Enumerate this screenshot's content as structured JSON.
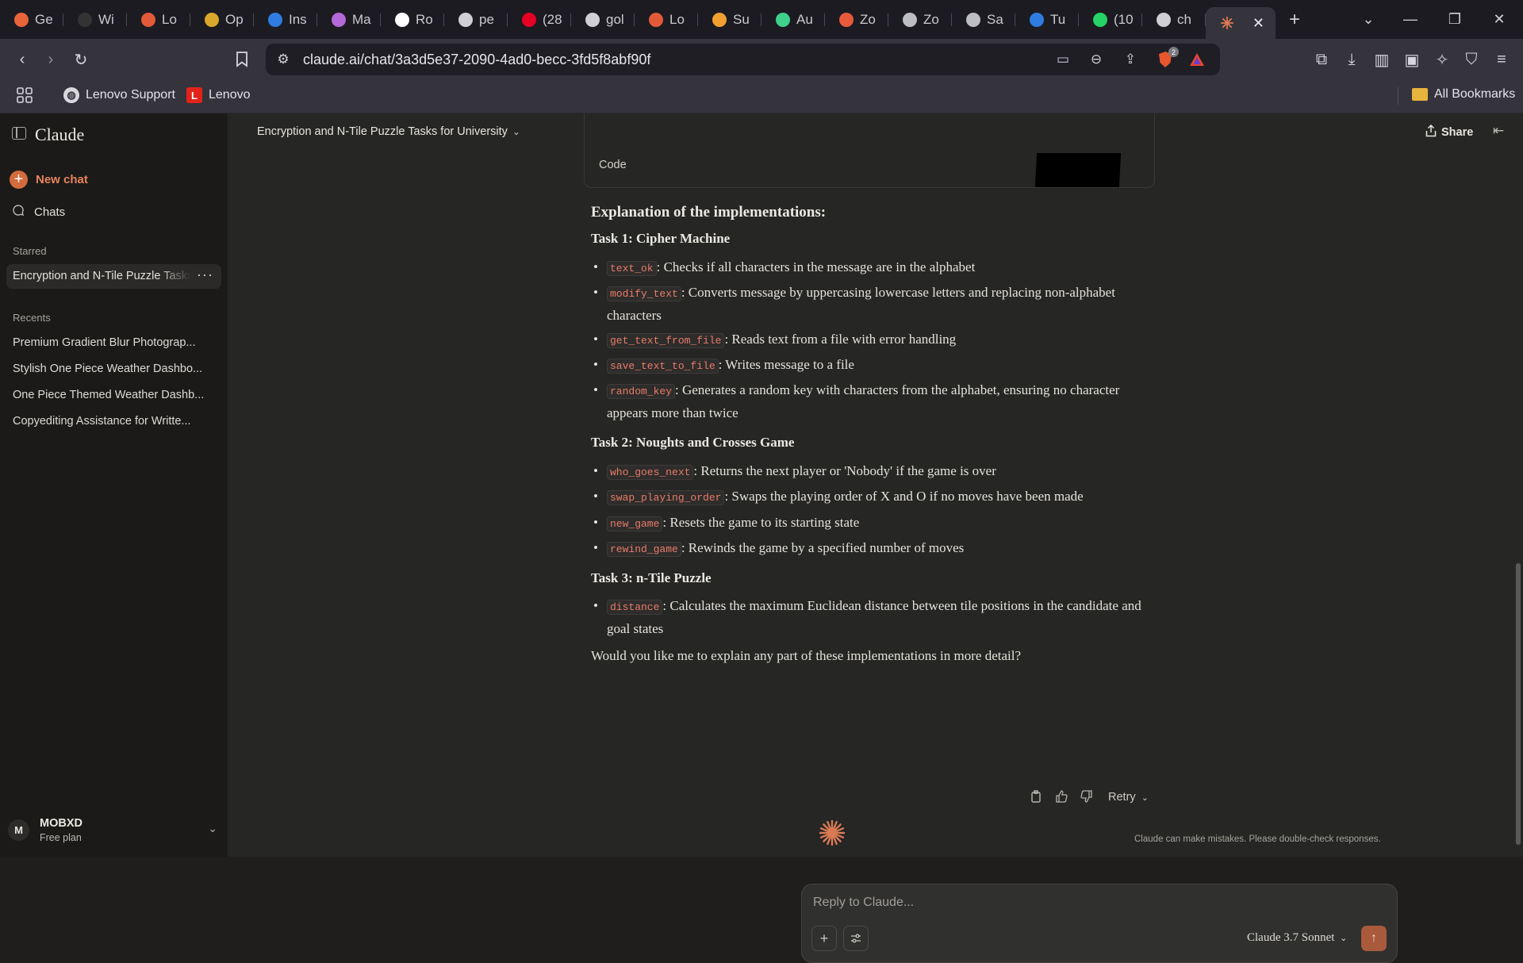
{
  "browser": {
    "tabs": [
      {
        "label": "Ge",
        "icon": "flame-icon",
        "color": "#e8643a"
      },
      {
        "label": "Wi",
        "icon": "circle-icon",
        "color": "#333333"
      },
      {
        "label": "Lo",
        "icon": "heart-icon",
        "color": "#e25a3a"
      },
      {
        "label": "Op",
        "icon": "eyes-icon",
        "color": "#d9a72b"
      },
      {
        "label": "Ins",
        "icon": "windows-icon",
        "color": "#2f7de1"
      },
      {
        "label": "Ma",
        "icon": "gradient-icon",
        "color": "#b469d6"
      },
      {
        "label": "Ro",
        "icon": "record-icon",
        "color": "#ffffff"
      },
      {
        "label": "pe",
        "icon": "shield-icon",
        "color": "#cfcfd5"
      },
      {
        "label": "(28",
        "icon": "pinterest-icon",
        "color": "#e60023"
      },
      {
        "label": "gol",
        "icon": "shield-icon",
        "color": "#cfcfd5"
      },
      {
        "label": "Lo",
        "icon": "heart-icon",
        "color": "#e25a3a"
      },
      {
        "label": "Su",
        "icon": "heart-icon",
        "color": "#f0a030"
      },
      {
        "label": "Au",
        "icon": "bolt-icon",
        "color": "#3fd18c"
      },
      {
        "label": "Zo",
        "icon": "dots-icon",
        "color": "#e85a3a"
      },
      {
        "label": "Zo",
        "icon": "globe-icon",
        "color": "#bdbdc4"
      },
      {
        "label": "Sa",
        "icon": "globe-icon",
        "color": "#bdbdc4"
      },
      {
        "label": "Tu",
        "icon": "ring-icon",
        "color": "#2f7de1"
      },
      {
        "label": "(10",
        "icon": "whatsapp-icon",
        "color": "#25d366"
      },
      {
        "label": "ch",
        "icon": "shield-icon",
        "color": "#cfcfd5"
      }
    ],
    "active_tab_icon": "claude-spark-icon",
    "url": "claude.ai/chat/3a3d5e37-2090-4ad0-becc-3fd5f8abf90f",
    "brave_badge": "2",
    "bookmarks": [
      {
        "label": "Lenovo Support",
        "icon": "globe-icon"
      },
      {
        "label": "Lenovo",
        "icon": "lenovo-icon",
        "glyph": "L"
      }
    ],
    "all_bookmarks": "All Bookmarks"
  },
  "sidebar": {
    "brand": "Claude",
    "new_chat": "New chat",
    "chats": "Chats",
    "starred_heading": "Starred",
    "starred_item": "Encryption and N-Tile Puzzle Tasks for University",
    "recents_heading": "Recents",
    "recents": [
      "Premium Gradient Blur Photograp...",
      "Stylish One Piece Weather Dashbo...",
      "One Piece Themed Weather Dashb...",
      "Copyediting Assistance for Writte..."
    ],
    "user": {
      "initial": "M",
      "name": "MOBXD",
      "plan": "Free plan"
    }
  },
  "header": {
    "title": "Encryption and N-Tile Puzzle Tasks for University",
    "share": "Share"
  },
  "message": {
    "code_label": "Code",
    "heading": "Explanation of the implementations:",
    "sections": [
      {
        "title": "Task 1: Cipher Machine",
        "items": [
          {
            "code": "text_ok",
            "text": ": Checks if all characters in the message are in the alphabet"
          },
          {
            "code": "modify_text",
            "text": ": Converts message by uppercasing lowercase letters and replacing non-alphabet characters"
          },
          {
            "code": "get_text_from_file",
            "text": ": Reads text from a file with error handling"
          },
          {
            "code": "save_text_to_file",
            "text": ": Writes message to a file"
          },
          {
            "code": "random_key",
            "text": ": Generates a random key with characters from the alphabet, ensuring no character appears more than twice"
          }
        ]
      },
      {
        "title": "Task 2: Noughts and Crosses Game",
        "items": [
          {
            "code": "who_goes_next",
            "text": ": Returns the next player or 'Nobody' if the game is over"
          },
          {
            "code": "swap_playing_order",
            "text": ": Swaps the playing order of X and O if no moves have been made"
          },
          {
            "code": "new_game",
            "text": ": Resets the game to its starting state"
          },
          {
            "code": "rewind_game",
            "text": ": Rewinds the game by a specified number of moves"
          }
        ]
      },
      {
        "title": "Task 3: n-Tile Puzzle",
        "items": [
          {
            "code": "distance",
            "text": ": Calculates the maximum Euclidean distance between tile positions in the candidate and goal states"
          }
        ]
      }
    ],
    "closing": "Would you like me to explain any part of these implementations in more detail?",
    "retry": "Retry",
    "disclaimer": "Claude can make mistakes. Please double-check responses."
  },
  "composer": {
    "placeholder": "Reply to Claude...",
    "model": "Claude 3.7 Sonnet"
  },
  "colors": {
    "accent": "#d46b3d",
    "code_text": "#e97b6a"
  }
}
